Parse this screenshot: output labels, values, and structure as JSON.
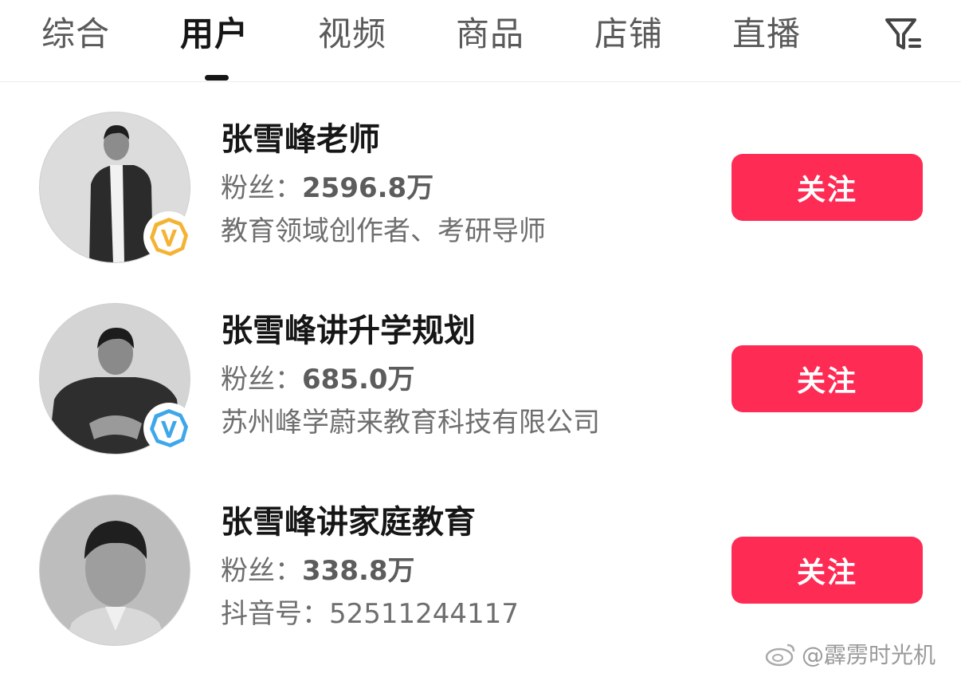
{
  "tabs": [
    {
      "label": "综合"
    },
    {
      "label": "用户"
    },
    {
      "label": "视频"
    },
    {
      "label": "商品"
    },
    {
      "label": "店铺"
    },
    {
      "label": "直播"
    }
  ],
  "active_tab": "用户",
  "users": [
    {
      "name": "张雪峰老师",
      "fans_label": "粉丝：",
      "fans_value": "2596.8万",
      "desc": "教育领域创作者、考研导师",
      "badge": "v-yellow-badge",
      "follow_label": "关注"
    },
    {
      "name": "张雪峰讲升学规划",
      "fans_label": "粉丝：",
      "fans_value": "685.0万",
      "desc": "苏州峰学蔚来教育科技有限公司",
      "badge": "v-blue-badge",
      "follow_label": "关注"
    },
    {
      "name": "张雪峰讲家庭教育",
      "fans_label": "粉丝：",
      "fans_value": "338.8万",
      "desc": "抖音号：52511244117",
      "badge": "",
      "follow_label": "关注"
    }
  ],
  "colors": {
    "accent": "#fe2c55",
    "badge_yellow": "#f5b335",
    "badge_blue": "#3ea7ea"
  },
  "watermark": "@霹雳时光机"
}
